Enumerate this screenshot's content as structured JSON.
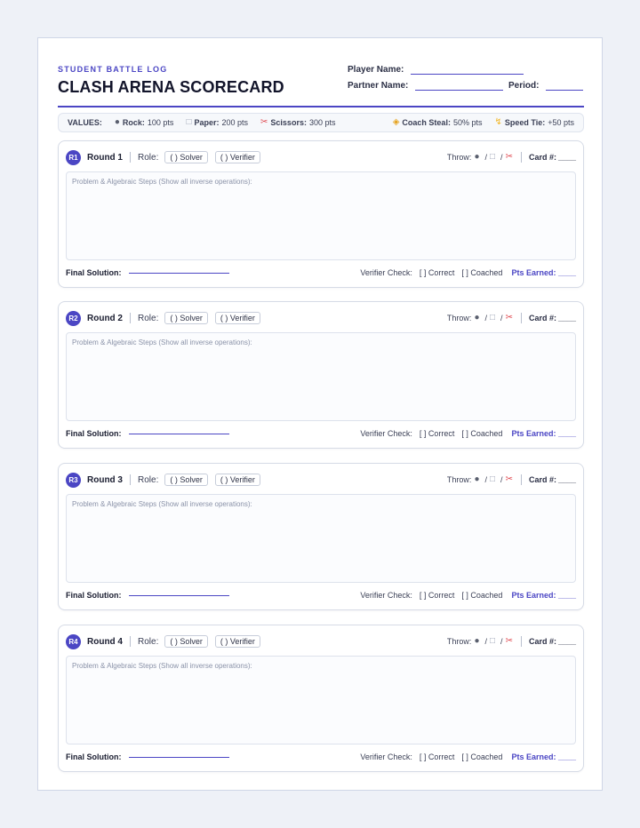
{
  "header": {
    "eyebrow": "STUDENT BATTLE LOG",
    "title": "CLASH ARENA SCORECARD",
    "player_label": "Player Name:",
    "partner_label": "Partner Name:",
    "period_label": "Period:"
  },
  "values": {
    "label": "VALUES:",
    "rock_label": "Rock:",
    "rock_value": "100 pts",
    "paper_label": "Paper:",
    "paper_value": "200 pts",
    "scissors_label": "Scissors:",
    "scissors_value": "300 pts",
    "coach_label": "Coach Steal:",
    "coach_value": "50% pts",
    "speed_label": "Speed Tie:",
    "speed_value": "+50 pts",
    "icons": [
      "rock-icon",
      "paper-icon",
      "scissors-icon",
      "handshake-icon",
      "lightning-icon"
    ]
  },
  "labels": {
    "role": "Role:",
    "solver": "( ) Solver",
    "verifier": "( ) Verifier",
    "throw": "Throw:",
    "slash": "/",
    "card": "Card #:",
    "blank": "____",
    "work_hint": "Problem & Algebraic Steps (Show all inverse operations):",
    "final": "Final Solution:",
    "verifier_check": "Verifier Check:",
    "correct": "[   ] Correct",
    "coached": "[   ] Coached",
    "pts": "Pts Earned:"
  },
  "rounds": [
    {
      "badge": "R1",
      "name": "Round 1"
    },
    {
      "badge": "R2",
      "name": "Round 2"
    },
    {
      "badge": "R3",
      "name": "Round 3"
    },
    {
      "badge": "R4",
      "name": "Round 4"
    }
  ],
  "colors": {
    "accent": "#4b46c4",
    "scissors": "#e0484f",
    "coach": "#e5a11a"
  }
}
